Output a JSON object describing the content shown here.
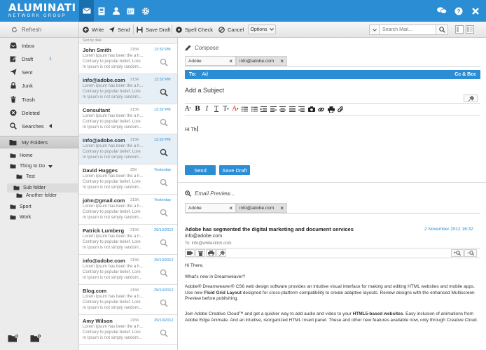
{
  "app": {
    "logo": "ALUMINATI",
    "logo_sub": "NETWORK GROUP",
    "nav": [
      "mail-icon",
      "address-book-icon",
      "user-icon",
      "calendar-icon",
      "gear-icon"
    ],
    "right_icons": [
      "chat-icon",
      "help-icon",
      "close-icon"
    ]
  },
  "toolbar": {
    "refresh": "Refresh",
    "write": "Write",
    "send": "Send",
    "save_draft": "Save Draft",
    "spell_check": "Spell Check",
    "cancel": "Cancel",
    "options": "Options",
    "search_placeholder": "Search Mail..."
  },
  "sidebar": {
    "items": [
      {
        "label": "Inbox",
        "icon": "inbox-icon"
      },
      {
        "label": "Draft",
        "icon": "draft-icon",
        "count": "1"
      },
      {
        "label": "Sent",
        "icon": "sent-icon"
      },
      {
        "label": "Junk",
        "icon": "junk-icon"
      },
      {
        "label": "Trash",
        "icon": "trash-icon"
      },
      {
        "label": "Deleted",
        "icon": "deleted-icon"
      },
      {
        "label": "Searches",
        "icon": "search-icon"
      }
    ],
    "my_folders": "My Folders",
    "folders": [
      {
        "label": "Home",
        "level": 0
      },
      {
        "label": "Thing to Do",
        "level": 0,
        "expanded": true
      },
      {
        "label": "Test",
        "level": 1
      },
      {
        "label": "Sub folder",
        "level": 1,
        "selected": true
      },
      {
        "label": "Another folder",
        "level": 1
      },
      {
        "label": "Sport",
        "level": 0
      },
      {
        "label": "Work",
        "level": 0
      }
    ]
  },
  "list": {
    "sort_label": "Sort by date",
    "messages": [
      {
        "from": "John Smith",
        "size": "215K",
        "time": "13:32 PM",
        "line1": "Lorem Ipsum has been the a h...",
        "line2": "Contrary to popular belief. Lore",
        "line3": "m Ipsum is not simply random...",
        "selected": false
      },
      {
        "from": "info@adobe.com",
        "size": "215K",
        "time": "13:32 PM",
        "line1": "Lorem Ipsum has been the a h...",
        "line2": "Contrary to popular belief. Lore",
        "line3": "m Ipsum is not simply random...",
        "selected": true
      },
      {
        "from": "Consultant",
        "size": "215K",
        "time": "13:32 PM",
        "line1": "Lorem Ipsum has been the a h...",
        "line2": "Contrary to popular belief. Lore",
        "line3": "m Ipsum is not simply random...",
        "selected": false
      },
      {
        "from": "info@adobe.com",
        "size": "215K",
        "time": "13:32 PM",
        "line1": "Lorem Ipsum has been the a h...",
        "line2": "Contrary to popular belief. Lore",
        "line3": "m Ipsum is not simply random...",
        "selected": true
      },
      {
        "from": "David Hugges",
        "size": "25K",
        "time": "Yesterday",
        "line1": "Lorem Ipsum has been the a h...",
        "line2": "Contrary to popular belief. Lore",
        "line3": "m Ipsum is not simply random...",
        "selected": false
      },
      {
        "from": "john@gmail.com",
        "size": "215K",
        "time": "Yesterday",
        "line1": "Lorem Ipsum has been the a h...",
        "line2": "Contrary to popular belief. Lore",
        "line3": "m Ipsum is not simply random...",
        "selected": false
      },
      {
        "from": "Patrick Lumberg",
        "size": "215K",
        "time": "29/10/2012",
        "line1": "Lorem Ipsum has been the a h...",
        "line2": "Contrary to popular belief. Lore",
        "line3": "m Ipsum is not simply random...",
        "selected": false
      },
      {
        "from": "info@adobe.com",
        "size": "215K",
        "time": "29/10/2012",
        "line1": "Lorem Ipsum has been the a h...",
        "line2": "Contrary to popular belief. Lore",
        "line3": "m Ipsum is not simply random...",
        "selected": false
      },
      {
        "from": "Blog.com",
        "size": "215K",
        "time": "29/10/2012",
        "line1": "Lorem Ipsum has been the a h...",
        "line2": "Contrary to popular belief. Lore",
        "line3": "m Ipsum is not simply random...",
        "selected": false
      },
      {
        "from": "Amy Wilson",
        "size": "215K",
        "time": "29/10/2012",
        "line1": "Lorem Ipsum has been the a h...",
        "line2": "Contrary to popular belief. Lore",
        "line3": "m Ipsum is not simply random...",
        "selected": false
      }
    ]
  },
  "compose": {
    "title": "Compose",
    "tabs": [
      {
        "label": "Adobe",
        "active": false
      },
      {
        "label": "info@adobe.com",
        "active": true
      }
    ],
    "to_label": "To:",
    "to_value": "Ad",
    "cc_bcc": "Cc & Bcc",
    "subject_placeholder": "Add a Subject",
    "body": "Hi Th",
    "send": "Send",
    "save_draft": "Save Draft"
  },
  "preview": {
    "title": "Email Preview...",
    "tabs": [
      {
        "label": "Adobe",
        "active": false
      },
      {
        "label": "info@adobe.com",
        "active": true
      }
    ],
    "subject": "Adobe has segmented the digital marketing and document services",
    "date": "2 November 2012 16:32",
    "from": "info@adobe.com",
    "to": "To: info@whitestitch.com",
    "zoom_in": "+",
    "zoom_out": "−",
    "greeting": "Hi There,",
    "p1": "What's new in Dreamweaver?",
    "p2_a": "Adobe® Dreamweaver® CS6 web design software provides an intuitive visual interface for making and editing HTML websites and mobile apps. Use new ",
    "p2_b": "Fluid Grid Layout",
    "p2_c": " designed for cross-platform compatibility to create adaptive layouts. Review designs with the enhanced Multiscreen Preview before publishing.",
    "p3_a": "Join Adobe Creative Cloud™ and get a quicker way to add audio and video to your ",
    "p3_b": "HTML5-based websites",
    "p3_c": ". Easy inclusion of animations from Adobe Edge Animate. And an intuitive, reorganized HTML Insert panel. These and other new features available now, only through Creative Cloud."
  },
  "colors": {
    "brand": "#2b8ed5",
    "brand_dark": "#1a6fae",
    "selected_row": "#e7eff6"
  }
}
